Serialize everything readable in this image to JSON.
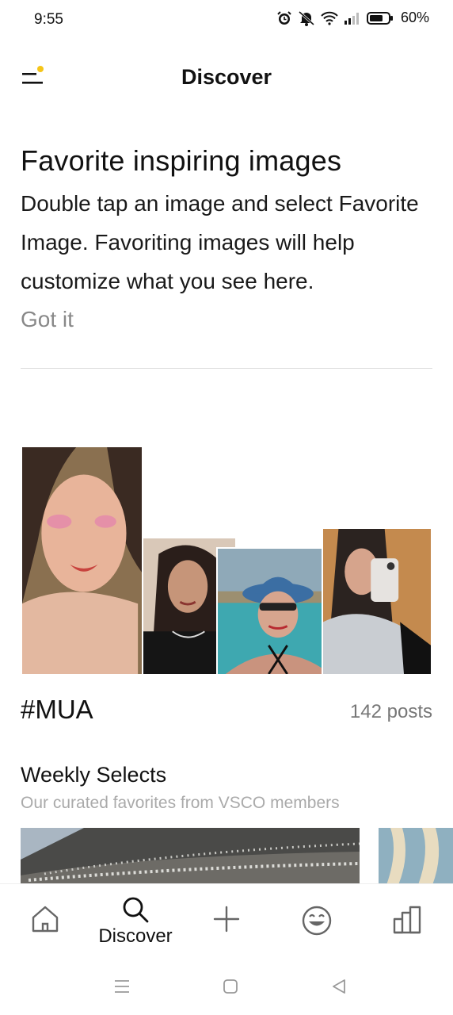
{
  "status_bar": {
    "time": "9:55",
    "battery": "60%",
    "icons": [
      "alarm-icon",
      "mute-icon",
      "wifi-icon",
      "signal-icon",
      "battery-icon"
    ]
  },
  "header": {
    "title": "Discover",
    "menu_icon": "menu-icon",
    "notification_dot_color": "#F5C518"
  },
  "tip": {
    "title": "Favorite inspiring images",
    "body": "Double tap an image and select Favorite Image. Favoriting images will help customize what you see here.",
    "action": "Got it"
  },
  "collection": {
    "tag": "#MUA",
    "count": "142 posts"
  },
  "weekly": {
    "title": "Weekly Selects",
    "subtitle": "Our curated favorites from VSCO members"
  },
  "bottom_nav": {
    "active": "discover",
    "items": [
      {
        "id": "home",
        "icon": "home-icon",
        "label": ""
      },
      {
        "id": "discover",
        "icon": "search-icon",
        "label": "Discover"
      },
      {
        "id": "add",
        "icon": "plus-icon",
        "label": ""
      },
      {
        "id": "studio",
        "icon": "smiley-icon",
        "label": ""
      },
      {
        "id": "profile",
        "icon": "grid-icon",
        "label": ""
      }
    ]
  },
  "system_nav": {
    "icons": [
      "recent-apps-icon",
      "home-button-icon",
      "back-icon"
    ]
  }
}
